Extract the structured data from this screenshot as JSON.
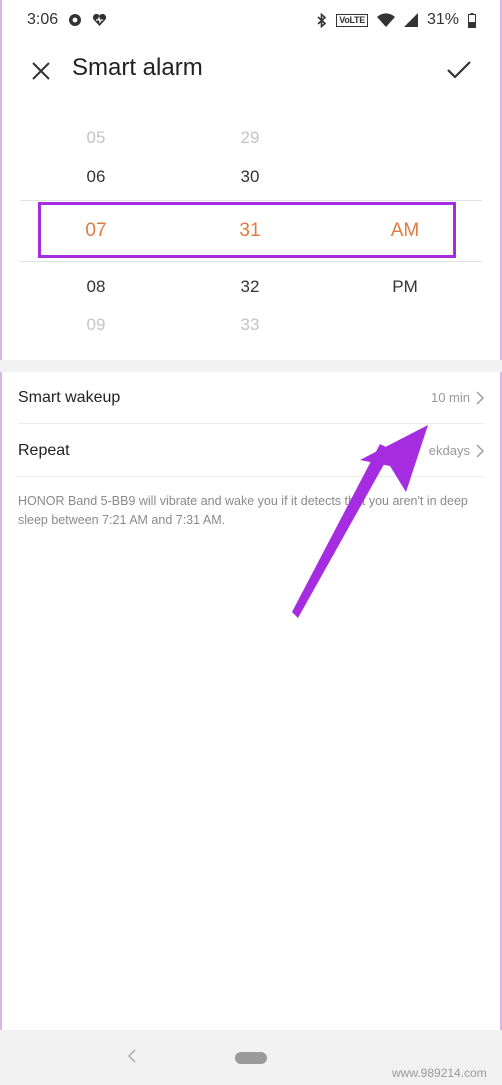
{
  "status_bar": {
    "time": "3:06",
    "volte": "VoLTE",
    "battery": "31%",
    "icons": [
      "settings-gear-icon",
      "heart-icon",
      "bluetooth-icon",
      "volte-icon",
      "wifi-icon",
      "signal-icon",
      "battery-icon"
    ]
  },
  "header": {
    "title": "Smart alarm",
    "close_icon": "close-icon",
    "confirm_icon": "check-icon"
  },
  "picker": {
    "hours": [
      "05",
      "06",
      "07",
      "08",
      "09"
    ],
    "minutes": [
      "29",
      "30",
      "31",
      "32",
      "33"
    ],
    "ampm": [
      "AM",
      "PM"
    ],
    "selected": {
      "hour": "07",
      "minute": "31",
      "period": "AM"
    },
    "highlight_color": "#a52ce0",
    "selected_color": "#e07a3e"
  },
  "settings": {
    "smart_wakeup": {
      "label": "Smart wakeup",
      "value": "10 min"
    },
    "repeat": {
      "label": "Repeat",
      "value": "ekdays"
    }
  },
  "description": "HONOR Band 5-BB9 will vibrate and wake you if it detects that you aren't in deep sleep between 7:21 AM and 7:31 AM.",
  "annotation": {
    "arrow_color": "#a52ce0"
  },
  "nav_bar": {
    "back_icon": "back-chevron-icon"
  },
  "watermark": "www.989214.com"
}
